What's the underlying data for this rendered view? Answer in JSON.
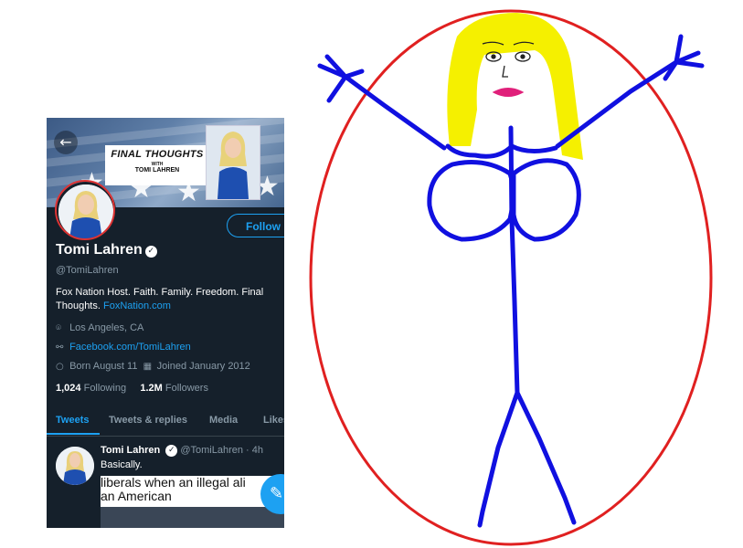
{
  "banner": {
    "title": "FINAL THOUGHTS",
    "with": "WITH",
    "host": "TOMI LAHREN"
  },
  "profile": {
    "follow_label": "Follow",
    "name": "Tomi Lahren",
    "handle": "@TomiLahren",
    "bio_text": "Fox Nation Host. Faith. Family. Freedom. Final Thoughts. ",
    "bio_link": "FoxNation.com",
    "location": "Los Angeles, CA",
    "website": "Facebook.com/TomiLahren",
    "born": "Born August 11",
    "joined": "Joined January 2012",
    "following_count": "1,024",
    "following_label": "Following",
    "followers_count": "1.2M",
    "followers_label": "Followers"
  },
  "tabs": [
    {
      "label": "Tweets",
      "active": true
    },
    {
      "label": "Tweets & replies",
      "active": false
    },
    {
      "label": "Media",
      "active": false
    },
    {
      "label": "Likes",
      "active": false
    }
  ],
  "tweet": {
    "author": "Tomi Lahren",
    "handle": "@TomiLahren",
    "time": "· 4h",
    "text": "Basically.",
    "media_line1": "liberals when an illegal ali",
    "media_line2": "an American"
  },
  "icons": {
    "back": "arrow-left-icon",
    "verified": "verified-badge-icon",
    "location": "location-pin-icon",
    "link": "link-icon",
    "birthday": "balloon-icon",
    "calendar": "calendar-icon",
    "compose": "compose-tweet-icon"
  },
  "colors": {
    "background": "#15202b",
    "accent": "#1da1f2",
    "muted": "#8899a6",
    "drawing_outline": "#e02020",
    "drawing_body": "#1010e0",
    "drawing_hair": "#f5f000",
    "drawing_lips": "#e0207a"
  }
}
